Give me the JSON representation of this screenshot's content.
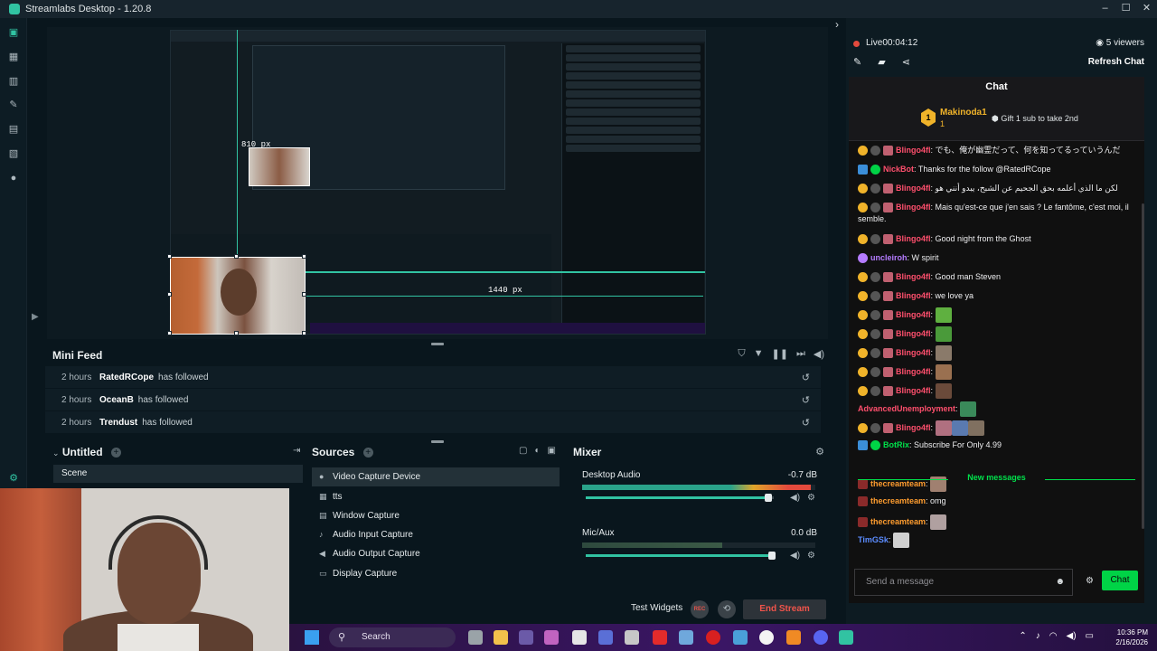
{
  "window": {
    "title": "Streamlabs Desktop - 1.20.8"
  },
  "preview": {
    "px_label_top": "810 px",
    "px_label_bottom": "1440 px"
  },
  "mini_feed": {
    "title": "Mini Feed",
    "rows": [
      {
        "time": "2 hours",
        "user": "RatedRCope",
        "action": "has followed"
      },
      {
        "time": "2 hours",
        "user": "OceanB",
        "action": "has followed"
      },
      {
        "time": "2 hours",
        "user": "Trendust",
        "action": "has followed"
      }
    ]
  },
  "scenes": {
    "title": "Untitled",
    "items": [
      "Scene"
    ]
  },
  "sources": {
    "title": "Sources",
    "items": [
      "Video Capture Device",
      "tts",
      "Window Capture",
      "Audio Input Capture",
      "Audio Output Capture",
      "Display Capture"
    ]
  },
  "mixer": {
    "title": "Mixer",
    "channels": [
      {
        "name": "Desktop Audio",
        "db": "-0.7 dB",
        "meter": 0.98,
        "volume": 0.96
      },
      {
        "name": "Mic/Aux",
        "db": "0.0 dB",
        "meter": 0.6,
        "volume": 1.0
      }
    ]
  },
  "footer": {
    "test_widgets": "Test Widgets",
    "rec": "REC",
    "end_stream": "End Stream"
  },
  "chat_pane": {
    "live": "Live",
    "live_time": "00:04:12",
    "viewers": "5 viewers",
    "refresh": "Refresh Chat",
    "chat_title": "Chat",
    "hype_user": "Makinoda1",
    "hype_count": "1",
    "hype_badge": "1",
    "gift_text": "Gift 1 sub to take 2nd",
    "new_messages": "New messages",
    "input_placeholder": "Send a message",
    "send_label": "Chat",
    "lines": [
      {
        "user": "Blingo4fl",
        "text": "でも、俺が幽霊だって、何を知ってるっていうんだ",
        "color": "#ff4f6d"
      },
      {
        "user": "NickBot",
        "text": "Thanks for the follow @RatedRCope",
        "color": "#ff4f6d"
      },
      {
        "user": "Blingo4fl",
        "text": "لكن ما الذي أعلمه بحق الجحيم عن الشبح، يبدو أنني هو",
        "color": "#ff4f6d"
      },
      {
        "user": "Blingo4fl",
        "text": "Mais qu'est-ce que j'en sais ? Le fantôme, c'est moi, il semble.",
        "color": "#ff4f6d"
      },
      {
        "user": "Blingo4fl",
        "text": "Good night from the Ghost",
        "color": "#ff4f6d"
      },
      {
        "user": "uncleiroh",
        "text": "W spirit",
        "color": "#b57cff"
      },
      {
        "user": "Blingo4fl",
        "text": "Good man Steven",
        "color": "#ff4f6d"
      },
      {
        "user": "Blingo4fl",
        "text": "we love ya",
        "color": "#ff4f6d"
      },
      {
        "user": "Blingo4fl",
        "text": "",
        "color": "#ff4f6d"
      },
      {
        "user": "Blingo4fl",
        "text": "",
        "color": "#ff4f6d"
      },
      {
        "user": "Blingo4fl",
        "text": "",
        "color": "#ff4f6d"
      },
      {
        "user": "Blingo4fl",
        "text": "",
        "color": "#ff4f6d"
      },
      {
        "user": "Blingo4fl",
        "text": "",
        "color": "#ff4f6d"
      },
      {
        "user": "AdvancedUnemployment",
        "text": "",
        "color": "#ff4f6d"
      },
      {
        "user": "Blingo4fl",
        "text": "",
        "color": "#ff4f6d"
      },
      {
        "user": "BotRix",
        "text": "Subscribe For Only 4.99",
        "color": "#00e14b"
      },
      {
        "user": "thecreamteam",
        "text": "",
        "color": "#ff9d2f"
      },
      {
        "user": "thecreamteam",
        "text": "omg",
        "color": "#ff9d2f"
      },
      {
        "user": "thecreamteam",
        "text": "",
        "color": "#ff9d2f"
      },
      {
        "user": "TimGSk",
        "text": "",
        "color": "#5b8cff"
      }
    ]
  },
  "taskbar": {
    "search": "Search",
    "time": "10:36 PM",
    "date": "2/16/2026"
  },
  "colors": {
    "accent": "#31c3a2",
    "live": "#e34a3d",
    "chat_green": "#00d346",
    "end_stream": "#f0544b"
  },
  "icons": [
    "studio-icon",
    "layout-icon",
    "themes-icon",
    "tools-icon",
    "store-icon",
    "widgets-icon",
    "record-icon"
  ]
}
